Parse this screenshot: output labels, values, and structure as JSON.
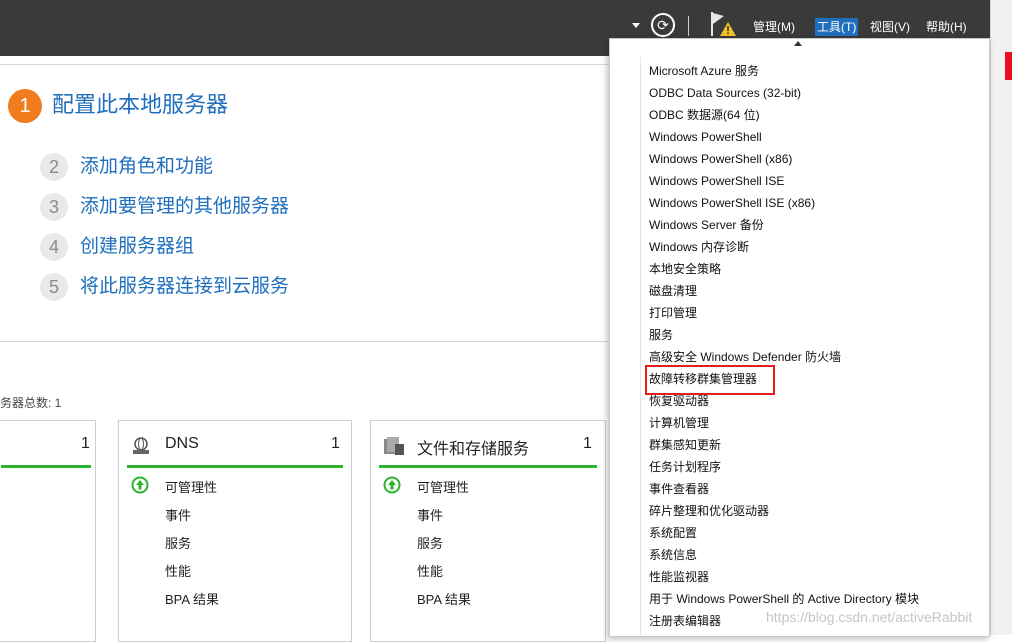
{
  "menubar": {
    "manage": "管理(M)",
    "tools": "工具(T)",
    "view": "视图(V)",
    "help": "帮助(H)"
  },
  "quickstart": {
    "step1_num": "1",
    "step1_label": "配置此本地服务器",
    "steps": [
      {
        "num": "2",
        "label": "添加角色和功能"
      },
      {
        "num": "3",
        "label": "添加要管理的其他服务器"
      },
      {
        "num": "4",
        "label": "创建服务器组"
      },
      {
        "num": "5",
        "label": "将此服务器连接到云服务"
      }
    ]
  },
  "servers": {
    "total_label": "务器总数: 1",
    "tiles": [
      {
        "title": "",
        "count": "1"
      },
      {
        "title": "DNS",
        "count": "1",
        "rows": [
          "可管理性",
          "事件",
          "服务",
          "性能",
          "BPA 结果"
        ]
      },
      {
        "title": "文件和存储服务",
        "count": "1",
        "rows": [
          "可管理性",
          "事件",
          "服务",
          "性能",
          "BPA 结果"
        ]
      }
    ]
  },
  "tools_menu": {
    "items": [
      "Microsoft Azure 服务",
      "ODBC Data Sources (32-bit)",
      "ODBC 数据源(64 位)",
      "Windows PowerShell",
      "Windows PowerShell (x86)",
      "Windows PowerShell ISE",
      "Windows PowerShell ISE (x86)",
      "Windows Server 备份",
      "Windows 内存诊断",
      "本地安全策略",
      "磁盘清理",
      "打印管理",
      "服务",
      "高级安全 Windows Defender 防火墙",
      "故障转移群集管理器",
      "恢复驱动器",
      "计算机管理",
      "群集感知更新",
      "任务计划程序",
      "事件查看器",
      "碎片整理和优化驱动器",
      "系统配置",
      "系统信息",
      "性能监视器",
      "用于 Windows PowerShell 的 Active Directory 模块",
      "注册表编辑器"
    ]
  },
  "watermark": "https://blog.csdn.net/activeRabbit",
  "colors": {
    "titlebar": "#3a3a3a",
    "accent": "#1f6fbd",
    "step1": "#f07c1e",
    "status_green": "#2db32d",
    "highlight": "#e02020"
  }
}
